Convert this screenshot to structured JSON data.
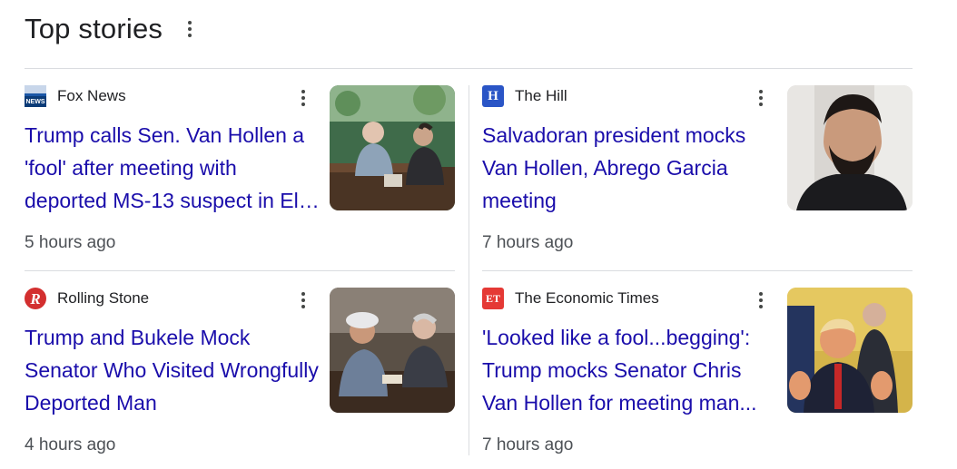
{
  "header": {
    "title": "Top stories",
    "menu_icon": "more-vert-icon"
  },
  "stories": [
    {
      "source": "Fox News",
      "favicon_text": "FOX NEWS",
      "headline": "Trump calls Sen. Van Hollen a 'fool' after meeting with deported MS-13 suspect in El Salvador",
      "time": "5 hours ago"
    },
    {
      "source": "The Hill",
      "favicon_text": "H",
      "favicon_color": "#2a55c6",
      "headline": "Salvadoran president mocks Van Hollen, Abrego Garcia meeting",
      "time": "7 hours ago"
    },
    {
      "source": "Rolling Stone",
      "favicon_text": "R",
      "favicon_color": "#d32f2f",
      "headline": "Trump and Bukele Mock Senator Who Visited Wrongfully Deported Man",
      "time": "4 hours ago"
    },
    {
      "source": "The Economic Times",
      "favicon_text": "ET",
      "favicon_color": "#e53935",
      "headline": "'Looked like a fool...begging': Trump mocks Senator Chris Van Hollen for meeting man...",
      "time": "7 hours ago"
    }
  ],
  "colors": {
    "link": "#1a0dab",
    "text": "#202124",
    "meta": "#4d5156",
    "divider": "#dadce0"
  }
}
